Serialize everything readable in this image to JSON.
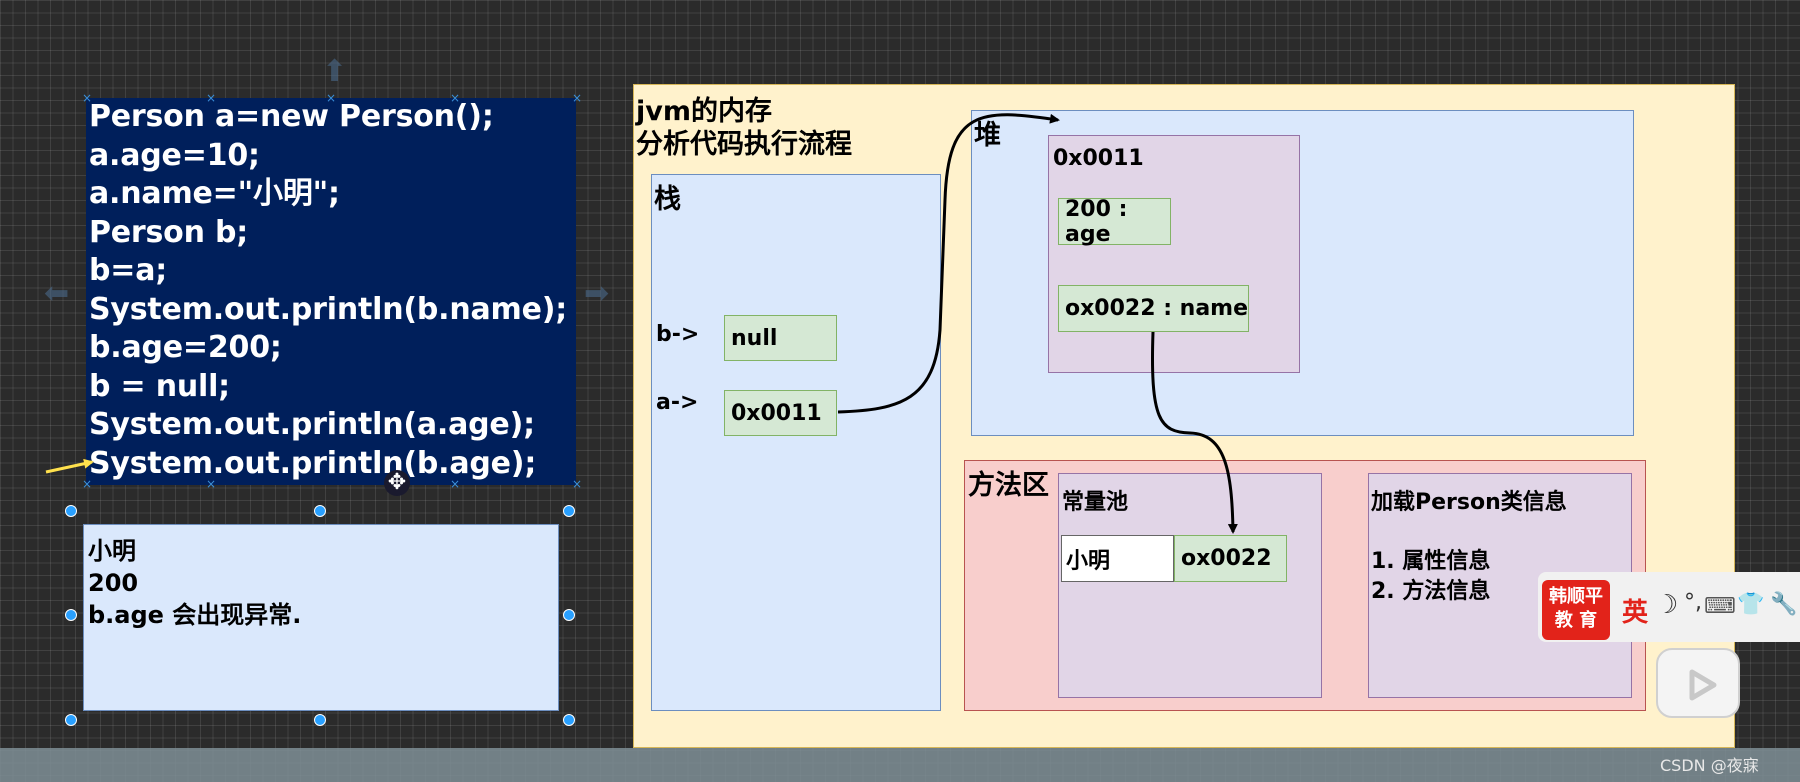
{
  "code": {
    "lines": [
      "Person a=new Person();",
      "a.age=10;",
      "a.name=\"小明\";",
      "Person b;",
      "b=a;",
      "System.out.println(b.name);",
      "b.age=200;",
      "b = null;",
      "System.out.println(a.age);",
      "System.out.println(b.age);"
    ]
  },
  "output": {
    "lines": [
      "小明",
      "200",
      "b.age 会出现异常."
    ]
  },
  "jvm": {
    "title_line1": "jvm的内存",
    "title_line2": "分析代码执行流程",
    "stack": {
      "label": "栈",
      "b_label": "b->",
      "b_value": "null",
      "a_label": "a->",
      "a_value": "0x0011"
    },
    "heap": {
      "label": "堆",
      "object_address": "0x0011",
      "age_field": "200 : age",
      "name_field": "ox0022 : name"
    },
    "method_area": {
      "label": "方法区",
      "constant_pool": {
        "label": "常量池",
        "string_value": "小明",
        "string_address": "ox0022"
      },
      "class_info": {
        "label": "加载Person类信息",
        "item1": "1. 属性信息",
        "item2": "2. 方法信息"
      }
    }
  },
  "ime": {
    "logo_line1": "韩顺平",
    "logo_line2": "教 育",
    "lang": "英",
    "moon_icon": "moon-icon",
    "punct": "°,",
    "keyboard_icon": "keyboard-icon",
    "skin_icon": "shirt-icon",
    "tool_icon": "wrench-icon"
  },
  "watermark": "CSDN @夜寐"
}
